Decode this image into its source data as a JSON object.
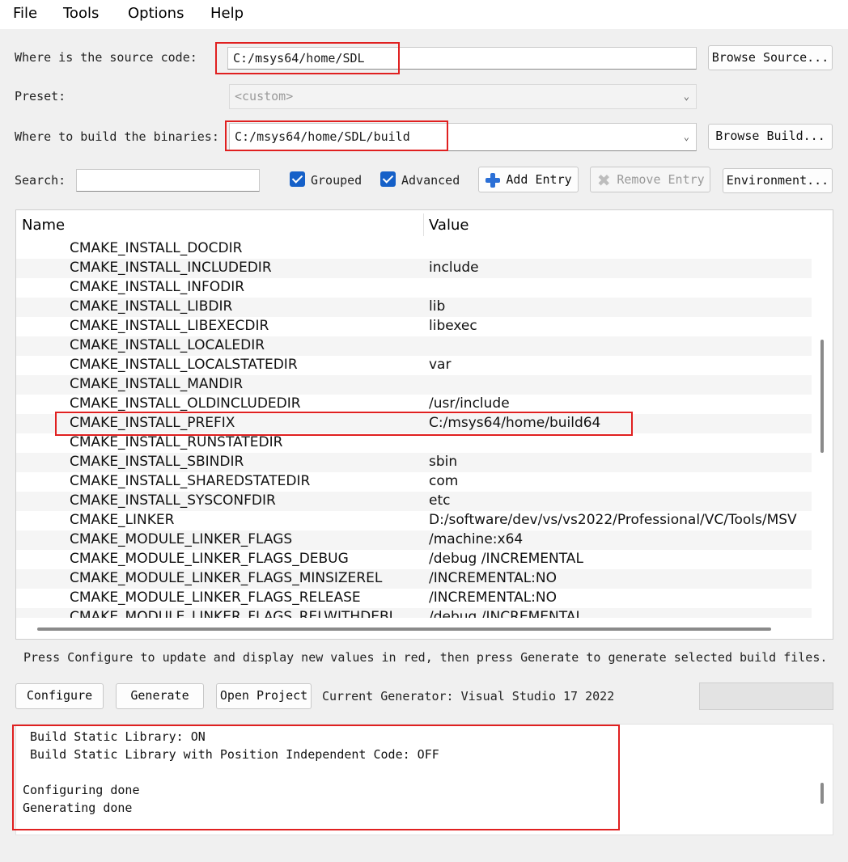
{
  "menu": {
    "file": "File",
    "tools": "Tools",
    "options": "Options",
    "help": "Help"
  },
  "source": {
    "label": "Where is the source code:",
    "value": "C:/msys64/home/SDL",
    "browse_label": "Browse Source..."
  },
  "preset": {
    "label": "Preset:",
    "value": "<custom>"
  },
  "build": {
    "label": "Where to build the binaries:",
    "value": "C:/msys64/home/SDL/build",
    "browse_label": "Browse Build..."
  },
  "search": {
    "label": "Search:",
    "value": ""
  },
  "options": {
    "grouped": {
      "label": "Grouped",
      "checked": true
    },
    "advanced": {
      "label": "Advanced",
      "checked": true
    }
  },
  "buttons": {
    "add_entry": "Add Entry",
    "remove_entry": "Remove Entry",
    "environment": "Environment..."
  },
  "table": {
    "headers": {
      "name": "Name",
      "value": "Value"
    },
    "rows": [
      {
        "name": "CMAKE_INSTALL_DOCDIR",
        "value": ""
      },
      {
        "name": "CMAKE_INSTALL_INCLUDEDIR",
        "value": "include"
      },
      {
        "name": "CMAKE_INSTALL_INFODIR",
        "value": ""
      },
      {
        "name": "CMAKE_INSTALL_LIBDIR",
        "value": "lib"
      },
      {
        "name": "CMAKE_INSTALL_LIBEXECDIR",
        "value": "libexec"
      },
      {
        "name": "CMAKE_INSTALL_LOCALEDIR",
        "value": ""
      },
      {
        "name": "CMAKE_INSTALL_LOCALSTATEDIR",
        "value": "var"
      },
      {
        "name": "CMAKE_INSTALL_MANDIR",
        "value": ""
      },
      {
        "name": "CMAKE_INSTALL_OLDINCLUDEDIR",
        "value": "/usr/include"
      },
      {
        "name": "CMAKE_INSTALL_PREFIX",
        "value": "C:/msys64/home/build64"
      },
      {
        "name": "CMAKE_INSTALL_RUNSTATEDIR",
        "value": ""
      },
      {
        "name": "CMAKE_INSTALL_SBINDIR",
        "value": "sbin"
      },
      {
        "name": "CMAKE_INSTALL_SHAREDSTATEDIR",
        "value": "com"
      },
      {
        "name": "CMAKE_INSTALL_SYSCONFDIR",
        "value": "etc"
      },
      {
        "name": "CMAKE_LINKER",
        "value": "D:/software/dev/vs/vs2022/Professional/VC/Tools/MSV"
      },
      {
        "name": "CMAKE_MODULE_LINKER_FLAGS",
        "value": "/machine:x64"
      },
      {
        "name": "CMAKE_MODULE_LINKER_FLAGS_DEBUG",
        "value": "/debug /INCREMENTAL"
      },
      {
        "name": "CMAKE_MODULE_LINKER_FLAGS_MINSIZEREL",
        "value": "/INCREMENTAL:NO"
      },
      {
        "name": "CMAKE_MODULE_LINKER_FLAGS_RELEASE",
        "value": "/INCREMENTAL:NO"
      },
      {
        "name": "CMAKE_MODULE_LINKER_FLAGS_RELWITHDEBI",
        "value": "/debug /INCREMENTAL"
      }
    ]
  },
  "hint": "Press Configure to update and display new values in red, then press Generate to generate selected build files.",
  "actions": {
    "configure": "Configure",
    "generate": "Generate",
    "open_project": "Open Project",
    "current_generator": "Current Generator: Visual Studio 17 2022"
  },
  "log": [
    " Build Static Library: ON",
    " Build Static Library with Position Independent Code: OFF",
    "",
    "Configuring done",
    "Generating done"
  ],
  "colors": {
    "highlight": "#e02020",
    "checkbox": "#1560c8",
    "add_icon": "#2b6fd6"
  }
}
